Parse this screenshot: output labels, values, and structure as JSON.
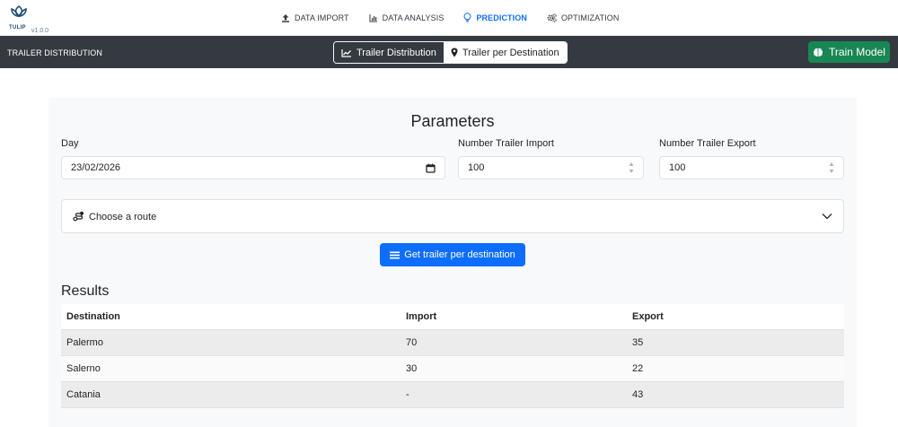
{
  "app": {
    "logo_text": "TULIP",
    "version": "v1.0.0"
  },
  "nav": {
    "items": [
      {
        "label": "DATA IMPORT",
        "icon": "upload-icon",
        "active": false
      },
      {
        "label": "DATA ANALYSIS",
        "icon": "chart-icon",
        "active": false
      },
      {
        "label": "PREDICTION",
        "icon": "lightbulb-icon",
        "active": true
      },
      {
        "label": "OPTIMIZATION",
        "icon": "gears-icon",
        "active": false
      }
    ]
  },
  "toolbar": {
    "title": "TRAILER DISTRIBUTION",
    "seg_distribution": "Trailer Distribution",
    "seg_destination": "Trailer per Destination",
    "train_label": "Train Model"
  },
  "params": {
    "title": "Parameters",
    "day_label": "Day",
    "day_value": "23/02/2026",
    "import_label": "Number Trailer Import",
    "import_value": "100",
    "export_label": "Number Trailer Export",
    "export_value": "100",
    "route_label": "Choose a route",
    "get_button": "Get trailer per destination"
  },
  "results": {
    "title": "Results",
    "headers": [
      "Destination",
      "Import",
      "Export"
    ],
    "rows": [
      [
        "Palermo",
        "70",
        "35"
      ],
      [
        "Salerno",
        "30",
        "22"
      ],
      [
        "Catania",
        "-",
        "43"
      ]
    ]
  },
  "colors": {
    "toolbar_bg": "#343a40",
    "primary": "#0d6efd",
    "success": "#198754",
    "panel_bg": "#f8f9fa"
  }
}
